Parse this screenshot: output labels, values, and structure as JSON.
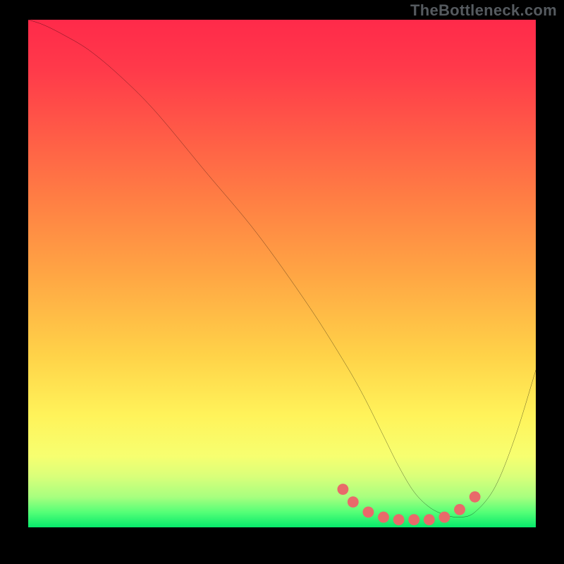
{
  "watermark": "TheBottleneck.com",
  "chart_data": {
    "type": "line",
    "title": "",
    "xlabel": "",
    "ylabel": "",
    "xlim": [
      0,
      100
    ],
    "ylim": [
      0,
      100
    ],
    "series": [
      {
        "name": "curve",
        "x": [
          0,
          3,
          7,
          12,
          18,
          25,
          35,
          45,
          55,
          62,
          66,
          70,
          73,
          76,
          79,
          82,
          85,
          88,
          92,
          96,
          100
        ],
        "values": [
          100,
          99,
          97,
          94,
          89,
          82,
          70,
          58,
          44,
          33,
          26,
          18,
          12,
          7,
          4,
          2.5,
          2,
          3,
          8,
          18,
          31
        ]
      }
    ],
    "markers": {
      "name": "dots",
      "color": "#e96a6a",
      "x": [
        62,
        64,
        67,
        70,
        73,
        76,
        79,
        82,
        85,
        88
      ],
      "values": [
        7.5,
        5,
        3,
        2,
        1.5,
        1.5,
        1.5,
        2,
        3.5,
        6
      ]
    },
    "gradient_stops": [
      {
        "pos": 0,
        "color": "#ff2a4a"
      },
      {
        "pos": 50,
        "color": "#ffa544"
      },
      {
        "pos": 80,
        "color": "#fff35a"
      },
      {
        "pos": 100,
        "color": "#06e96b"
      }
    ]
  }
}
